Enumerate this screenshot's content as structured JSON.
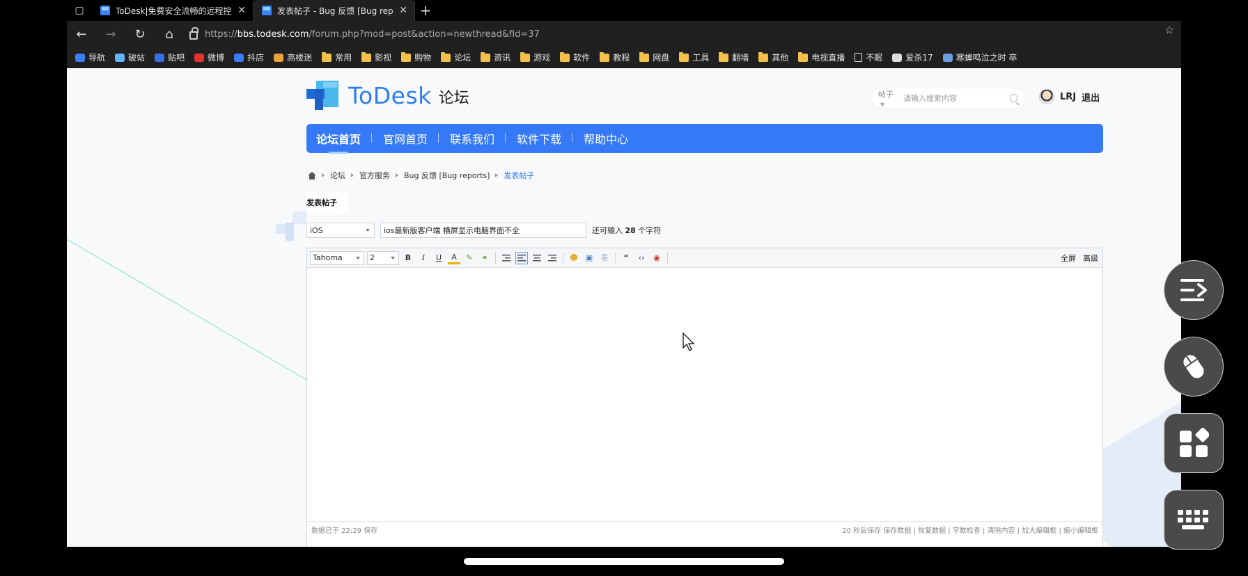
{
  "browser": {
    "tabs": [
      {
        "title": "ToDesk|免费安全流畅的远程控制",
        "active": false
      },
      {
        "title": "发表帖子 - Bug 反馈 [Bug report",
        "active": true
      }
    ],
    "url": {
      "scheme": "https://",
      "host": "bbs.todesk.com",
      "path": "/forum.php?mod=post&action=newthread&fid=37"
    },
    "bookmarks": [
      {
        "label": "导航",
        "icon": "site-icon",
        "color": "#3b7df6"
      },
      {
        "label": "破站",
        "icon": "tv-icon",
        "color": "#5fb6ff"
      },
      {
        "label": "贴吧",
        "icon": "paw-icon",
        "color": "#3a6ee8"
      },
      {
        "label": "微博",
        "icon": "weibo-icon",
        "color": "#e6322e"
      },
      {
        "label": "抖店",
        "icon": "douyin-icon",
        "color": "#3b7df6"
      },
      {
        "label": "高楼迷",
        "icon": "site-icon",
        "color": "#e9a23b"
      },
      {
        "label": "常用",
        "icon": "folder-icon"
      },
      {
        "label": "影视",
        "icon": "folder-icon"
      },
      {
        "label": "购物",
        "icon": "folder-icon"
      },
      {
        "label": "论坛",
        "icon": "folder-icon"
      },
      {
        "label": "资讯",
        "icon": "folder-icon"
      },
      {
        "label": "游戏",
        "icon": "folder-icon"
      },
      {
        "label": "软件",
        "icon": "folder-icon"
      },
      {
        "label": "教程",
        "icon": "folder-icon"
      },
      {
        "label": "网盘",
        "icon": "folder-icon"
      },
      {
        "label": "工具",
        "icon": "folder-icon"
      },
      {
        "label": "翻墙",
        "icon": "folder-icon"
      },
      {
        "label": "其他",
        "icon": "folder-icon"
      },
      {
        "label": "电视直播",
        "icon": "folder-icon"
      },
      {
        "label": "不眠",
        "icon": "doc-icon"
      },
      {
        "label": "爱杀17",
        "icon": "site-icon",
        "color": "#dddddd"
      },
      {
        "label": "寒蝉鸣泣之时 卒",
        "icon": "site-icon",
        "color": "#6aa0e0"
      }
    ]
  },
  "site": {
    "logo_text": "ToDesk",
    "logo_sub": "论坛",
    "search": {
      "type_label": "帖子",
      "placeholder": "请输入搜索内容"
    },
    "user": {
      "name": "LRJ",
      "logout": "退出"
    },
    "nav": [
      "论坛首页",
      "官网首页",
      "联系我们",
      "软件下载",
      "帮助中心"
    ],
    "breadcrumb": [
      "论坛",
      "官方服务",
      "Bug 反馈 [Bug reports]",
      "发表帖子"
    ],
    "post_tab": "发表帖子",
    "form": {
      "type_value": "iOS",
      "subject_value": "ios最新版客户端 横屏显示电脑界面不全",
      "remain_prefix": "还可输入",
      "remain_count": "28",
      "remain_suffix": "个字符"
    },
    "editor": {
      "font": "Tahoma",
      "size": "2",
      "fullscreen": "全屏",
      "advanced": "高级",
      "status_left": "数据已于 22:29 保存",
      "status_right": "20 秒后保存 保存数据 | 恢复数据 | 字数检查 | 清除内容 | 加大编辑框 | 缩小编辑框"
    }
  },
  "colors": {
    "nav_blue": "#3579f6",
    "logo_blue": "#2e7ef0",
    "link_blue": "#2e7ef0"
  },
  "floating_controls": [
    "menu-collapse-icon",
    "mouse-icon",
    "apps-icon",
    "keyboard-icon"
  ]
}
